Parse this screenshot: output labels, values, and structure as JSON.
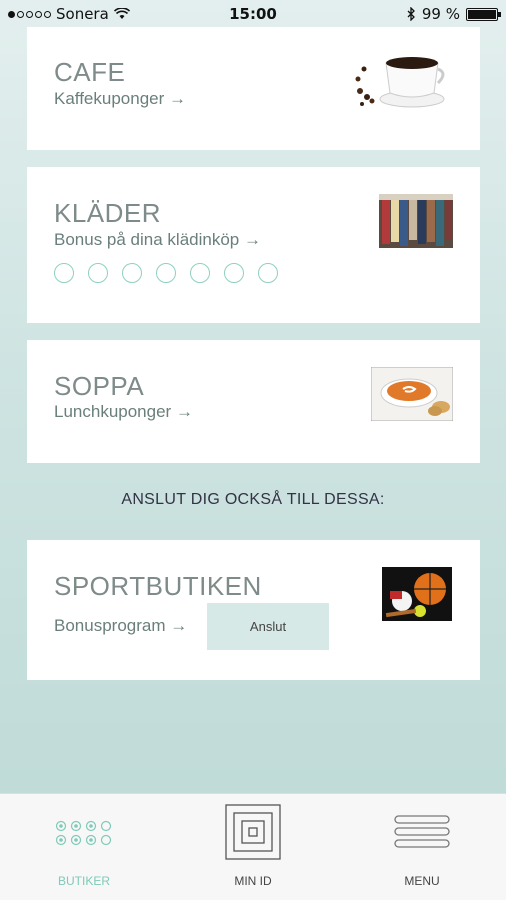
{
  "status_bar": {
    "carrier": "Sonera",
    "time": "15:00",
    "battery_percent": "99 %",
    "battery_level": 0.99,
    "signal_bars_filled": 1,
    "signal_bars_total": 5
  },
  "cards": [
    {
      "title": "CAFE",
      "subtitle": "Kaffekuponger",
      "arrow": "→",
      "image": "coffee-cup"
    },
    {
      "title": "KLÄDER",
      "subtitle": "Bonus på dina klädinköp",
      "arrow": "→",
      "image": "clothes-rack",
      "stamps_total": 7,
      "stamps_filled": 0
    },
    {
      "title": "SOPPA",
      "subtitle": "Lunchkuponger",
      "arrow": "→",
      "image": "soup-bowl"
    }
  ],
  "section_heading": "ANSLUT DIG OCKSÅ TILL DESSA:",
  "offer_card": {
    "title": "SPORTBUTIKEN",
    "subtitle": "Bonusprogram",
    "arrow": "→",
    "button_label": "Anslut",
    "image": "sports-balls"
  },
  "tabbar": {
    "tabs": [
      {
        "label": "BUTIKER",
        "icon": "stores-grid-icon",
        "active": true
      },
      {
        "label": "MIN ID",
        "icon": "qr-id-icon",
        "active": false
      },
      {
        "label": "MENU",
        "icon": "hamburger-menu-icon",
        "active": false
      }
    ]
  },
  "colors": {
    "accent": "#7fcab8",
    "background_top": "#e3efee",
    "background_bottom": "#bcd9d6",
    "button_bg": "#d6e9e6"
  }
}
